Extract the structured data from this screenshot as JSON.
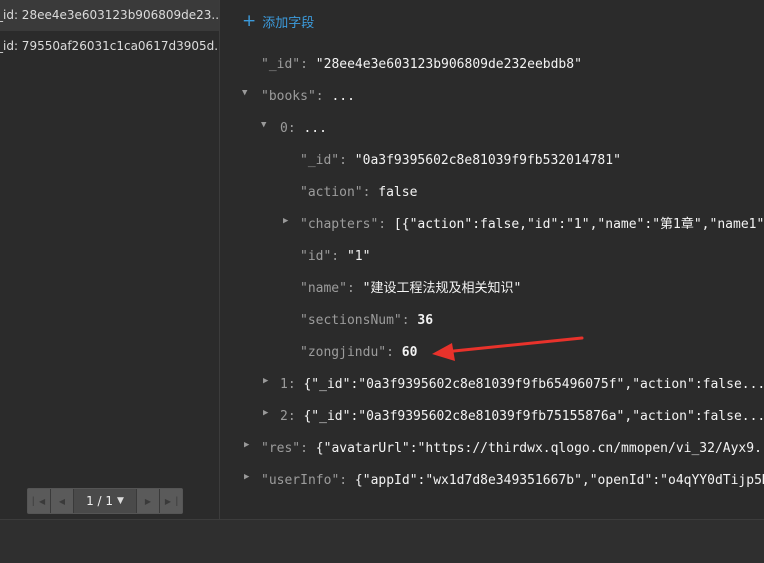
{
  "sidebar": {
    "records": [
      "_id: 28ee4e3e603123b906809de23...",
      "_id: 79550af26031c1ca0617d3905d..."
    ],
    "pager": {
      "info": "1 / 1"
    }
  },
  "toolbar": {
    "add_field_label": "添加字段"
  },
  "doc": {
    "id_key": "\"_id\":",
    "id_val": "\"28ee4e3e603123b906809de232eebdb8\"",
    "books_key": "\"books\":",
    "books_val": "...",
    "b0_key": "0:",
    "b0_val": "...",
    "b0_id_key": "\"_id\":",
    "b0_id_val": "\"0a3f9395602c8e81039f9fb532014781\"",
    "b0_action_key": "\"action\":",
    "b0_action_val": "false",
    "b0_chapters_key": "\"chapters\":",
    "b0_chapters_val": "[{\"action\":false,\"id\":\"1\",\"name\":\"第1章\",\"name1\"",
    "b0_idnum_key": "\"id\":",
    "b0_idnum_val": "\"1\"",
    "b0_name_key": "\"name\":",
    "b0_name_val": "\"建设工程法规及相关知识\"",
    "b0_sections_key": "\"sectionsNum\":",
    "b0_sections_val": "36",
    "b0_zong_key": "\"zongjindu\":",
    "b0_zong_val": "60",
    "b1_key": "1:",
    "b1_val": "{\"_id\":\"0a3f9395602c8e81039f9fb65496075f\",\"action\":false...}",
    "b2_key": "2:",
    "b2_val": "{\"_id\":\"0a3f9395602c8e81039f9fb75155876a\",\"action\":false...}",
    "res_key": "\"res\":",
    "res_val": "{\"avatarUrl\":\"https://thirdwx.qlogo.cn/mmopen/vi_32/Ayx9...",
    "user_key": "\"userInfo\":",
    "user_val": "{\"appId\":\"wx1d7d8e349351667b\",\"openId\":\"o4qYY0dTijp5N"
  },
  "colors": {
    "accent": "#3c9bdc",
    "annotation_arrow": "#e8322b"
  },
  "icons": {
    "add": "plus-icon",
    "expand": "triangle-right-icon",
    "collapse": "triangle-down-icon",
    "first": "first-page-icon",
    "prev": "prev-page-icon",
    "next": "next-page-icon",
    "last": "last-page-icon",
    "dropdown": "chevron-down-icon"
  }
}
